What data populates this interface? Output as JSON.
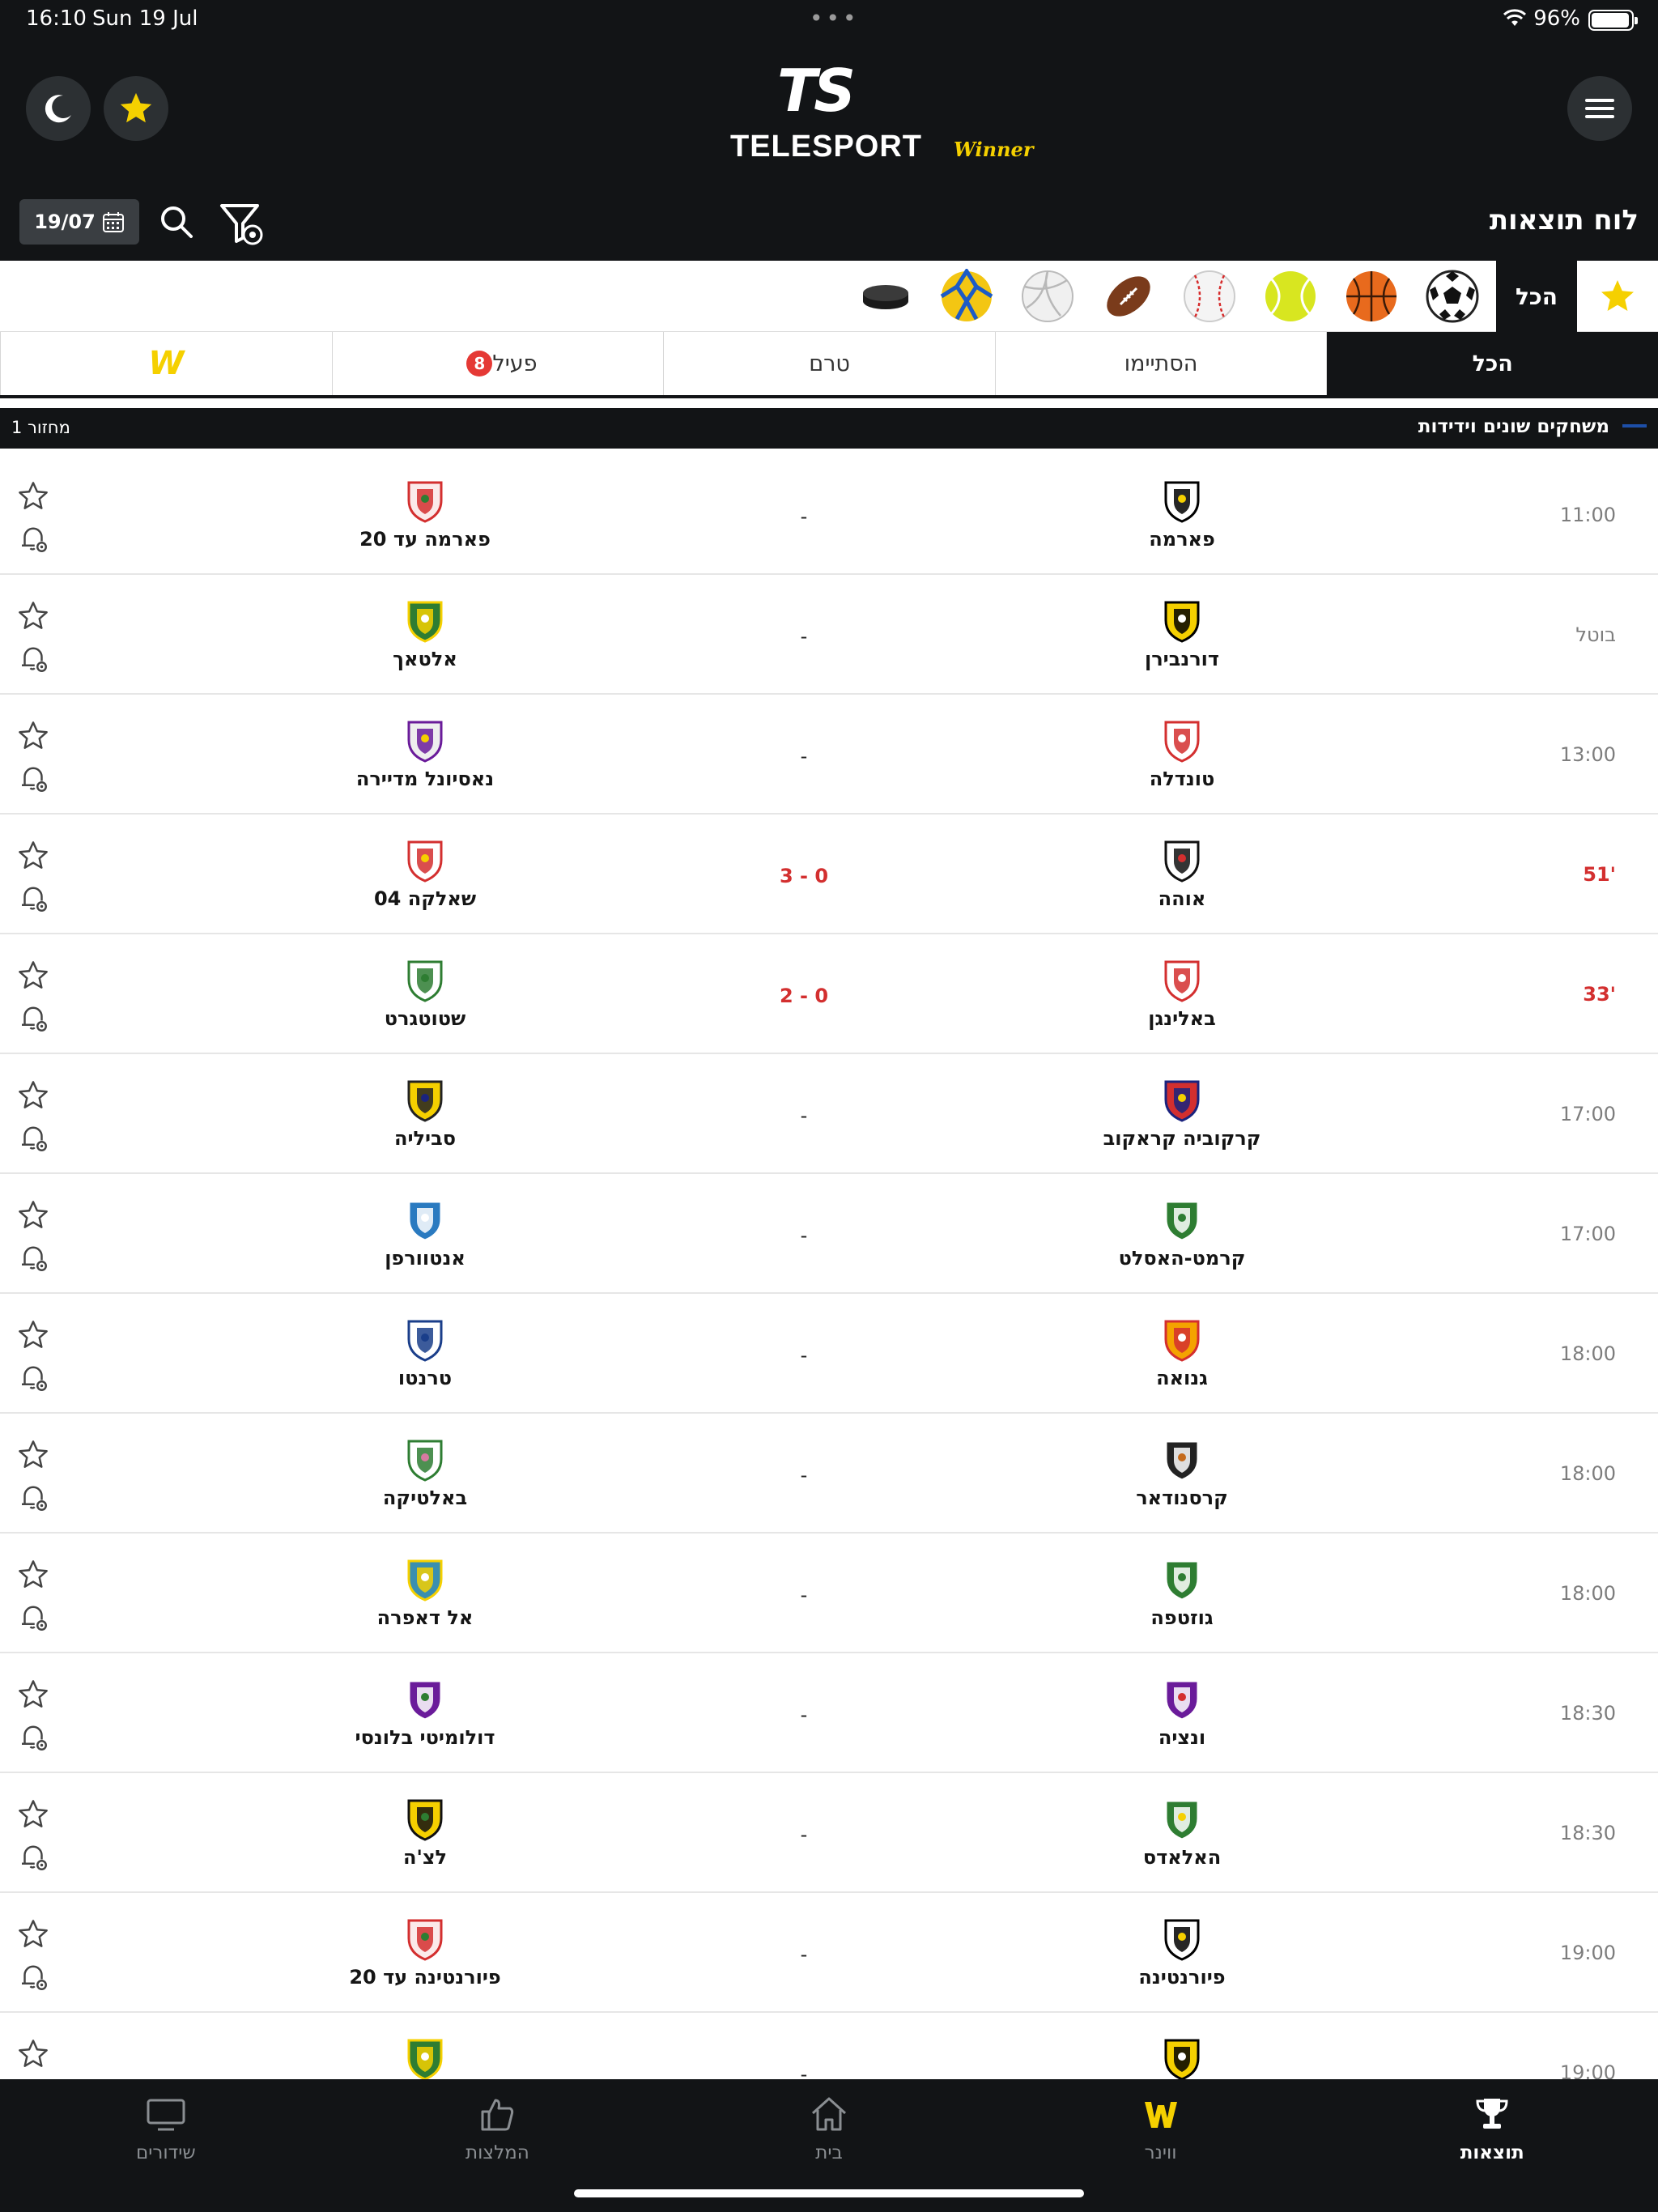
{
  "status_bar": {
    "time": "16:10",
    "date": "Sun 19 Jul",
    "battery": "96%",
    "battery_fraction": 0.96
  },
  "header": {
    "logo_main": "TS",
    "logo_wordmark": "TELESPORT",
    "logo_partner": "Winner"
  },
  "toolbar": {
    "date": "19/07",
    "title": "לוח תוצאות"
  },
  "sports": {
    "all_label": "הכל",
    "icons": [
      "star-icon",
      "soccer-ball-icon",
      "basketball-icon",
      "tennis-ball-icon",
      "baseball-icon",
      "american-football-icon",
      "volleyball-icon",
      "handball-icon",
      "hockey-puck-icon"
    ]
  },
  "tabs": [
    {
      "label": "הכל",
      "active": true
    },
    {
      "label": "הסתיימו",
      "active": false
    },
    {
      "label": "טרם",
      "active": false
    },
    {
      "label": "פעיל",
      "badge": "8",
      "active": false
    },
    {
      "label": "W",
      "active": false
    }
  ],
  "league": {
    "name": "משחקים שונים וידידות",
    "round": "מחזור 1"
  },
  "colors": {
    "dark": "#121416",
    "accent_yellow": "#f5d000",
    "live_red": "#d32f2f"
  },
  "matches": [
    {
      "time": "11:00",
      "home": "פארמה",
      "away": "פארמה עד 20",
      "score": "-",
      "live": false
    },
    {
      "time": "בוטל",
      "home": "דורנבירן",
      "away": "אלטאך",
      "score": "-",
      "live": false
    },
    {
      "time": "13:00",
      "home": "טונדלה",
      "away": "נאסיונל מדיירה",
      "score": "-",
      "live": false
    },
    {
      "time": "51'",
      "home": "אוהה",
      "away": "שאלקה 04",
      "score": "3 - 0",
      "live": true
    },
    {
      "time": "33'",
      "home": "באלינגן",
      "away": "שטוטגרט",
      "score": "2 - 0",
      "live": true
    },
    {
      "time": "17:00",
      "home": "קרקוביה קראקוב",
      "away": "סביליה",
      "score": "-",
      "live": false
    },
    {
      "time": "17:00",
      "home": "קרמט-האסלט",
      "away": "אנטוורפן",
      "score": "-",
      "live": false
    },
    {
      "time": "18:00",
      "home": "גנואה",
      "away": "טרנטו",
      "score": "-",
      "live": false
    },
    {
      "time": "18:00",
      "home": "קרסנודאר",
      "away": "באלטיקה",
      "score": "-",
      "live": false
    },
    {
      "time": "18:00",
      "home": "גוזטפה",
      "away": "אל דאפרה",
      "score": "-",
      "live": false
    },
    {
      "time": "18:30",
      "home": "ונציה",
      "away": "דולומיטי בלונסי",
      "score": "-",
      "live": false
    },
    {
      "time": "18:30",
      "home": "האלאדס",
      "away": "לצ'ה",
      "score": "-",
      "live": false
    },
    {
      "time": "19:00",
      "home": "פיורנטינה",
      "away": "פיורנטינה עד 20",
      "score": "-",
      "live": false
    },
    {
      "time": "19:00",
      "home": "",
      "away": "",
      "score": "-",
      "live": false
    }
  ],
  "bottom_nav": [
    {
      "label": "תוצאות",
      "icon": "trophy-icon",
      "active": true
    },
    {
      "label": "ווינר",
      "icon": "winner-icon",
      "active": false
    },
    {
      "label": "בית",
      "icon": "home-icon",
      "active": false
    },
    {
      "label": "המלצות",
      "icon": "thumbs-up-icon",
      "active": false
    },
    {
      "label": "שידורים",
      "icon": "tv-icon",
      "active": false
    }
  ]
}
